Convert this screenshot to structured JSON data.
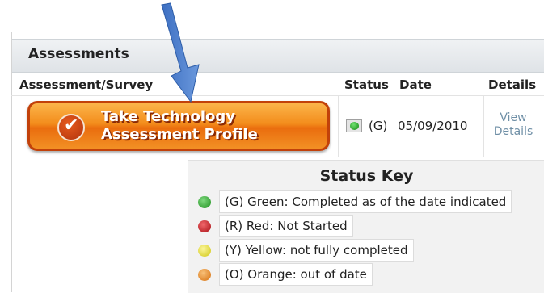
{
  "section": {
    "title": "Assessments"
  },
  "columns": {
    "assessment": "Assessment/Survey",
    "status": "Status",
    "date": "Date",
    "details": "Details"
  },
  "row": {
    "button_label": "Take Technology\nAssessment Profile",
    "status_code": "(G)",
    "status_color": "#1f9a1f",
    "date": "05/09/2010",
    "details_link": "View\nDetails"
  },
  "status_key": {
    "title": "Status Key",
    "items": [
      {
        "label": "(G) Green: Completed as of the date indicated",
        "color": "#34a334"
      },
      {
        "label": "(R) Red: Not Started",
        "color": "#c0141b"
      },
      {
        "label": "(Y) Yellow: not fully completed",
        "color": "#e7e21c"
      },
      {
        "label": "(O) Orange: out of date",
        "color": "#e98a1c"
      }
    ]
  },
  "icons": {
    "arrow": "down-arrow-icon",
    "check": "checkmark-icon",
    "status": "status-light-icon"
  }
}
